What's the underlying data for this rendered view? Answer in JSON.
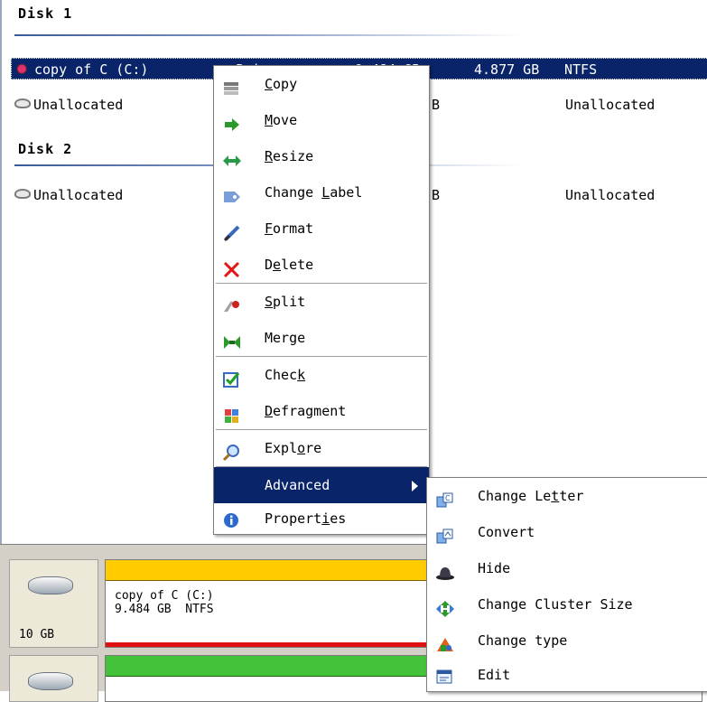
{
  "disks": [
    {
      "header": "Disk 1"
    },
    {
      "header": "Disk 2"
    }
  ],
  "rows": [
    {
      "name": "copy of C (C:)",
      "col2": "Primary",
      "col3": "9.484 GB",
      "col4": "4.877 GB",
      "col5": "NTFS"
    },
    {
      "name": "Unallocated",
      "col3": "B",
      "status": "Unallocated"
    },
    {
      "name": "Unallocated",
      "col3": "B",
      "status": "Unallocated"
    }
  ],
  "context_menu": {
    "items": [
      {
        "pre": "",
        "key": "C",
        "post": "opy"
      },
      {
        "pre": "",
        "key": "M",
        "post": "ove"
      },
      {
        "pre": "",
        "key": "R",
        "post": "esize"
      },
      {
        "pre": "Change ",
        "key": "L",
        "post": "abel"
      },
      {
        "pre": "",
        "key": "F",
        "post": "ormat"
      },
      {
        "pre": "D",
        "key": "e",
        "post": "lete"
      },
      {
        "pre": "",
        "key": "S",
        "post": "plit"
      },
      {
        "pre": "Merge",
        "key": "",
        "post": ""
      },
      {
        "pre": "Chec",
        "key": "k",
        "post": ""
      },
      {
        "pre": "",
        "key": "D",
        "post": "efragment"
      },
      {
        "pre": "Expl",
        "key": "o",
        "post": "re"
      },
      {
        "pre": "Advanced",
        "key": "",
        "post": ""
      },
      {
        "pre": "Propert",
        "key": "i",
        "post": "es"
      }
    ]
  },
  "submenu": {
    "items": [
      {
        "pre": "Change Le",
        "key": "t",
        "post": "ter"
      },
      {
        "pre": "Convert",
        "key": "",
        "post": ""
      },
      {
        "pre": "Hide",
        "key": "",
        "post": ""
      },
      {
        "pre": "Change Cluster Size",
        "key": "",
        "post": ""
      },
      {
        "pre": "Change type",
        "key": "",
        "post": ""
      },
      {
        "pre": "Edit",
        "key": "",
        "post": ""
      }
    ]
  },
  "disk_map": [
    {
      "size": "10 GB",
      "partition_name": "copy of C (C:)",
      "partition_info": "9.484 GB  NTFS"
    }
  ],
  "colors": {
    "selection": "#0a246a",
    "bar_primary": "#ffcc00",
    "bar_green": "#44c23a",
    "bar_used": "#e01010"
  }
}
